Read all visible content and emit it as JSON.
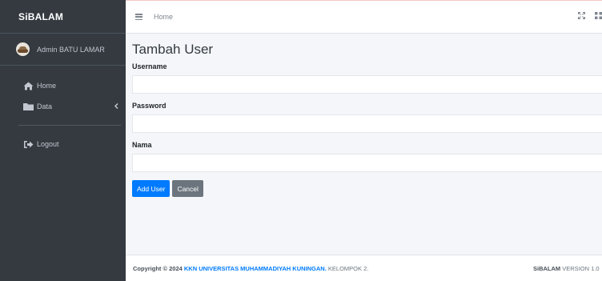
{
  "sidebar": {
    "brand": "SiBALAM",
    "user_name": "Admin BATU LAMAR",
    "items": [
      {
        "label": "Home",
        "icon": "home-icon"
      },
      {
        "label": "Data",
        "icon": "folder-icon"
      },
      {
        "label": "Logout",
        "icon": "logout-icon"
      }
    ]
  },
  "navbar": {
    "home_link": "Home",
    "icons": [
      "menu-icon",
      "fullscreen-icon",
      "grid-icon"
    ]
  },
  "main": {
    "title": "Tambah User",
    "fields": [
      {
        "label": "Username",
        "value": ""
      },
      {
        "label": "Password",
        "value": ""
      },
      {
        "label": "Nama",
        "value": ""
      }
    ],
    "buttons": {
      "submit": "Add User",
      "cancel": "Cancel"
    }
  },
  "footer": {
    "copyright_prefix": "Copyright © 2024",
    "org": "KKN UNIVERSITAS MUHAMMADIYAH KUNINGAN.",
    "group": "KELOMPOK 2.",
    "app_name": "SiBALAM",
    "version": "VERSION 1.0"
  },
  "colors": {
    "sidebar_bg": "#343a40",
    "primary": "#007bff",
    "secondary": "#6c757d",
    "content_bg": "#f4f6f9"
  }
}
